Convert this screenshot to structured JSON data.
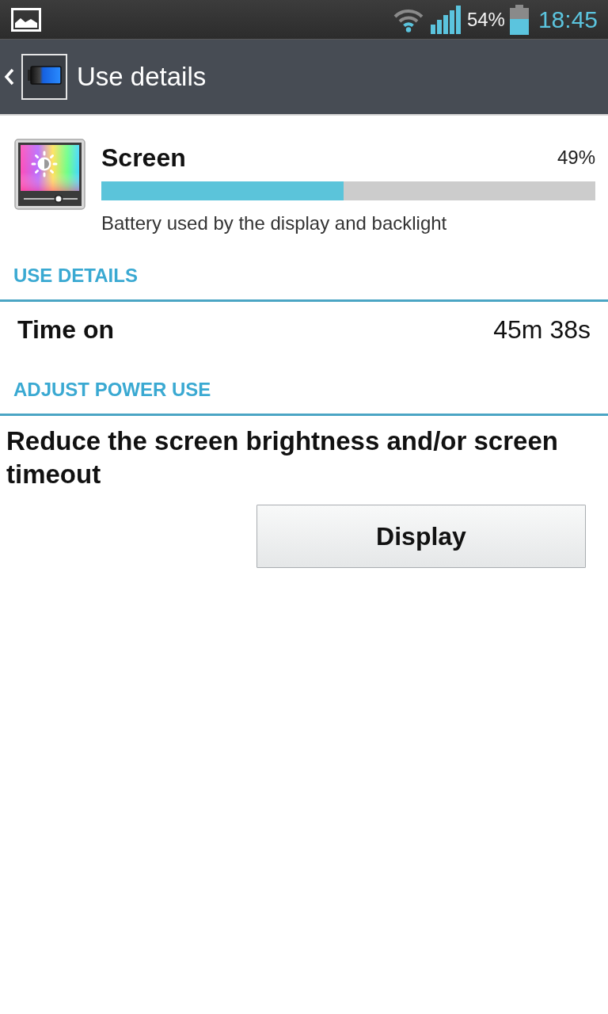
{
  "status_bar": {
    "battery_percent": "54%",
    "time": "18:45"
  },
  "action_bar": {
    "title": "Use details"
  },
  "usage": {
    "name": "Screen",
    "percent": "49%",
    "level": 0.49,
    "description": "Battery used by the display and backlight"
  },
  "sections": [
    {
      "header": "USE DETAILS",
      "items": [
        {
          "kind": "detail",
          "label": "Time on",
          "value": "45m 38s"
        }
      ]
    },
    {
      "header": "ADJUST POWER USE",
      "items": [
        {
          "kind": "action",
          "text": "Reduce the screen brightness and/or screen timeout",
          "button": "Display"
        }
      ]
    }
  ]
}
